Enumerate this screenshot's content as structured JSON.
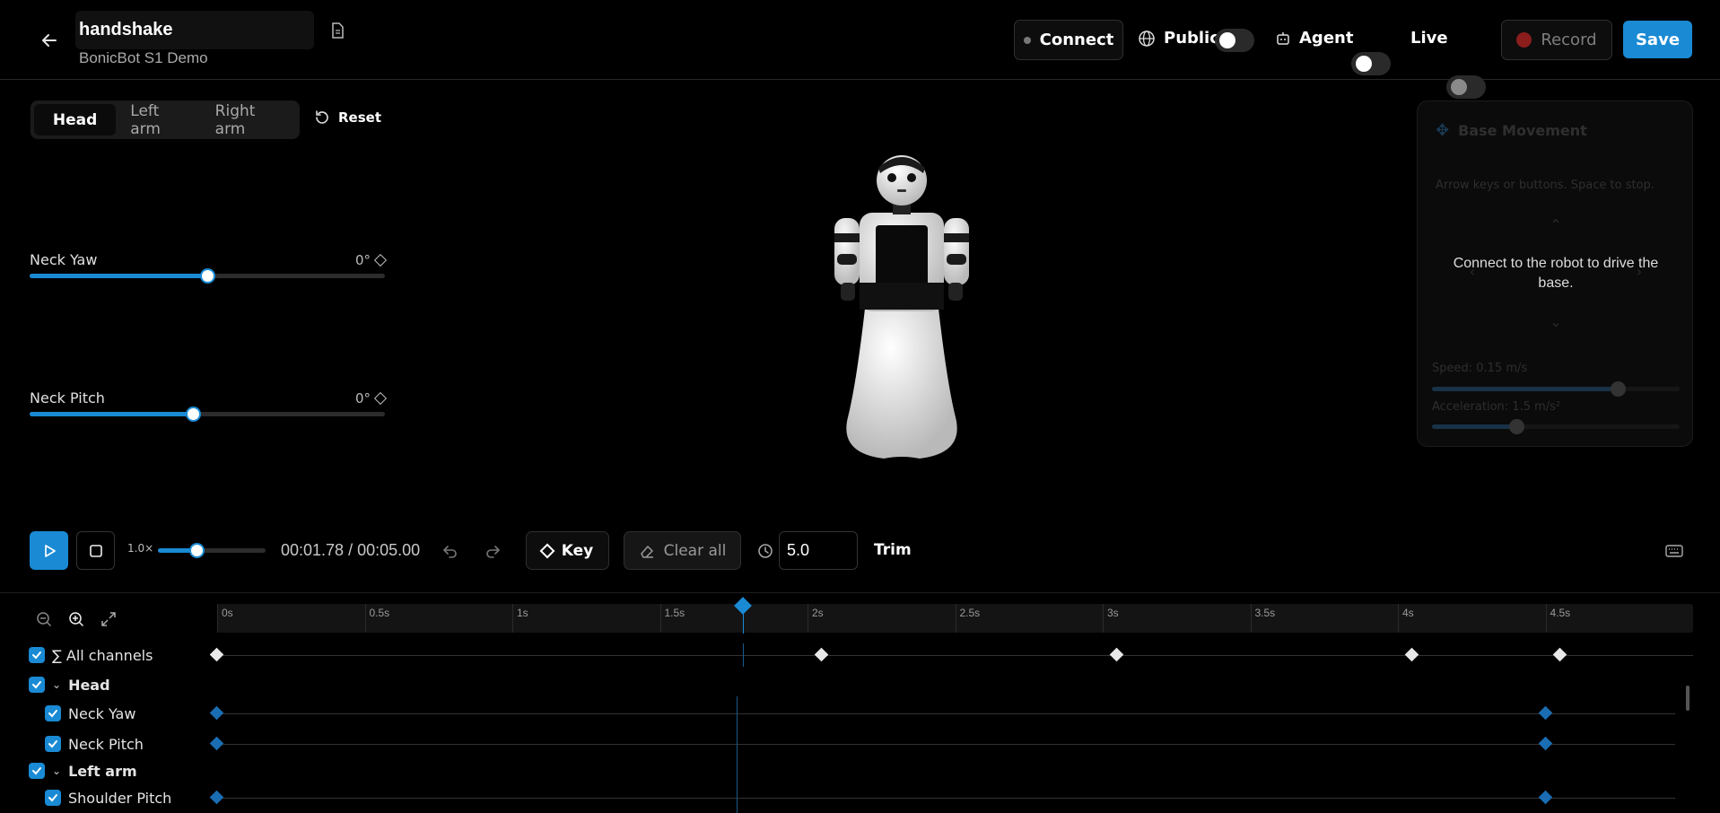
{
  "header": {
    "title": "handshake",
    "subtitle": "BonicBot S1 Demo",
    "connect_label": "Connect",
    "public_label": "Public",
    "agent_label": "Agent",
    "live_label": "Live",
    "record_label": "Record",
    "save_label": "Save",
    "public_on": true,
    "agent_on": true,
    "live_on": false
  },
  "tabs": [
    {
      "label": "Head",
      "active": true
    },
    {
      "label": "Left arm",
      "active": false
    },
    {
      "label": "Right arm",
      "active": false
    }
  ],
  "reset_label": "Reset",
  "joints": [
    {
      "label": "Neck Yaw",
      "value": "0°",
      "level": 0.5
    },
    {
      "label": "Neck Pitch",
      "value": "0°",
      "level": 0.46
    }
  ],
  "base_panel": {
    "title": "Base Movement",
    "hint": "Arrow keys or buttons. Space to stop.",
    "overlay": "Connect to the robot to drive the base.",
    "speed_label": "Speed: 0.15 m/s",
    "speed_level": 0.75,
    "accel_label": "Acceleration: 1.5 m/s²",
    "accel_level": 0.34
  },
  "transport": {
    "speed": "1.0×",
    "speed_level": 0.36,
    "time": "00:01.78 / 00:05.00",
    "key_label": "Key",
    "clear_label": "Clear all",
    "duration": "5.0",
    "trim_label": "Trim"
  },
  "timeline": {
    "ticks": [
      "0s",
      "0.5s",
      "1s",
      "1.5s",
      "2s",
      "2.5s",
      "3s",
      "3.5s",
      "4s",
      "4.5s"
    ],
    "playhead_time": 1.78,
    "duration": 5.0,
    "rows": [
      {
        "label": "∑ All channels",
        "indent": 0,
        "group": false,
        "keys": [
          0,
          2.05,
          3.05,
          4.05,
          4.55
        ],
        "color": "white"
      },
      {
        "label": "Head",
        "indent": 0,
        "group": true,
        "keys": []
      },
      {
        "label": "Neck Yaw",
        "indent": 1,
        "group": false,
        "keys": [
          0,
          4.5
        ],
        "color": "blue"
      },
      {
        "label": "Neck Pitch",
        "indent": 1,
        "group": false,
        "keys": [
          0,
          4.5
        ],
        "color": "blue"
      },
      {
        "label": "Left arm",
        "indent": 0,
        "group": true,
        "keys": []
      },
      {
        "label": "Shoulder Pitch",
        "indent": 1,
        "group": false,
        "keys": [
          0,
          4.5
        ],
        "color": "blue"
      }
    ]
  },
  "colors": {
    "accent": "#1a8ad4",
    "record_dot": "#8b1d1d",
    "background": "#000000"
  }
}
